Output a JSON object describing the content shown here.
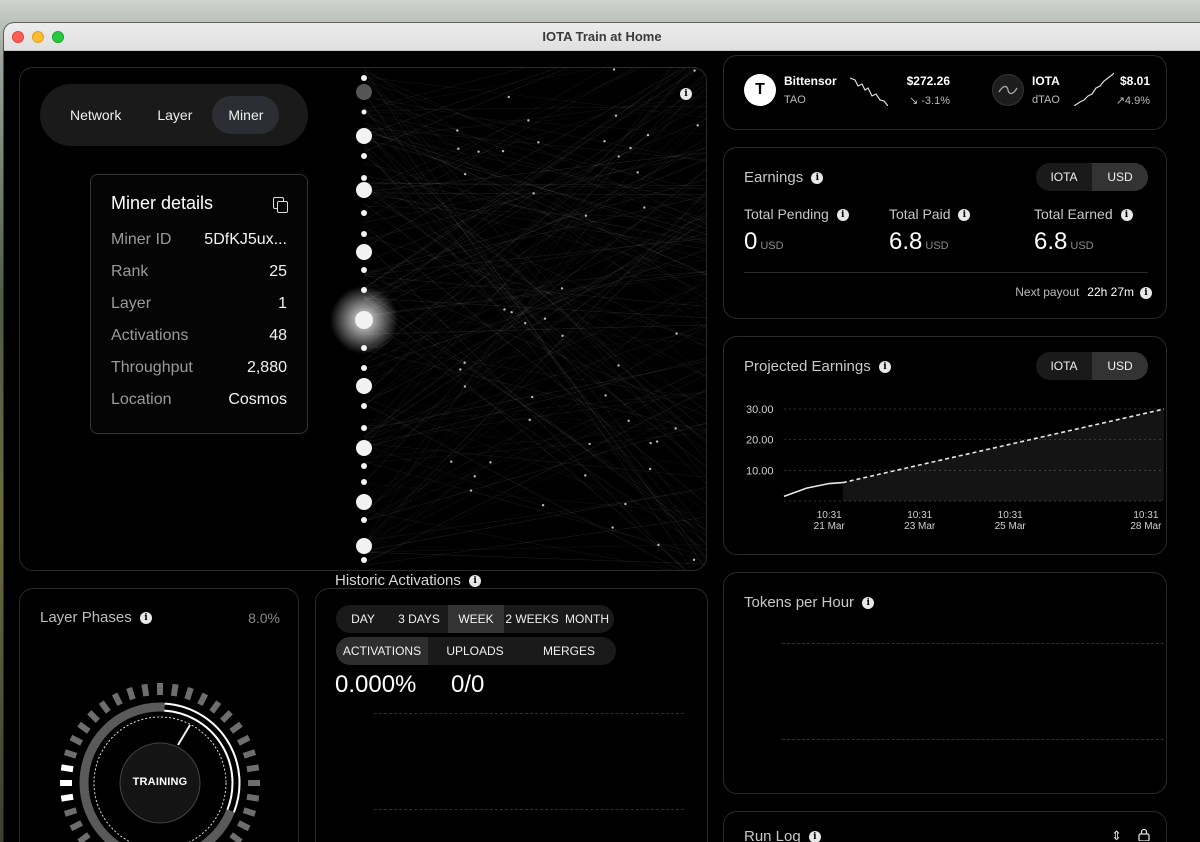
{
  "window": {
    "title": "IOTA Train at Home"
  },
  "view_tabs": [
    "Network",
    "Layer",
    "Miner"
  ],
  "active_view_tab": "Miner",
  "miner_details": {
    "title": "Miner details",
    "rows": [
      {
        "key": "Miner ID",
        "value": "5DfKJ5ux..."
      },
      {
        "key": "Rank",
        "value": "25"
      },
      {
        "key": "Layer",
        "value": "1"
      },
      {
        "key": "Activations",
        "value": "48"
      },
      {
        "key": "Throughput",
        "value": "2,880"
      },
      {
        "key": "Location",
        "value": "Cosmos"
      }
    ]
  },
  "ticker": {
    "bittensor": {
      "logo": "T",
      "name": "Bittensor",
      "symbol": "TAO",
      "price": "$272.26",
      "change": "↘ -3.1%"
    },
    "iota": {
      "name": "IOTA",
      "symbol": "dTAO",
      "price": "$8.01",
      "change": "↗4.9%"
    }
  },
  "earnings": {
    "title": "Earnings",
    "currency_options": [
      "IOTA",
      "USD"
    ],
    "active_currency": "USD",
    "items": [
      {
        "label": "Total Pending",
        "value": "0",
        "unit": "USD"
      },
      {
        "label": "Total Paid",
        "value": "6.8",
        "unit": "USD"
      },
      {
        "label": "Total Earned",
        "value": "6.8",
        "unit": "USD"
      }
    ],
    "next_payout_label": "Next payout",
    "next_payout_value": "22h 27m"
  },
  "projected": {
    "title": "Projected Earnings",
    "currency_options": [
      "IOTA",
      "USD"
    ],
    "active_currency": "USD"
  },
  "chart_data": {
    "type": "line",
    "title": "Projected Earnings",
    "ylim": [
      0,
      30
    ],
    "yticks": [
      "30.00",
      "20.00",
      "10.00"
    ],
    "xticks": [
      {
        "time": "10:31",
        "date": "21 Mar"
      },
      {
        "time": "10:31",
        "date": "23 Mar"
      },
      {
        "time": "10:31",
        "date": "25 Mar"
      },
      {
        "time": "10:31",
        "date": "28 Mar"
      }
    ],
    "series": [
      {
        "style": "solid",
        "x": [
          "20 Mar",
          "20.5 Mar",
          "21 Mar",
          "21.3 Mar"
        ],
        "values": [
          1.5,
          4.2,
          5.7,
          6.0
        ]
      },
      {
        "style": "dashed",
        "x": [
          "21.3 Mar",
          "28.4 Mar"
        ],
        "values": [
          6.0,
          30.0
        ]
      }
    ],
    "grid": true
  },
  "layer_phases": {
    "title": "Layer Phases",
    "percent": "8.0%",
    "phase": "TRAINING"
  },
  "historic": {
    "title": "Historic Activations",
    "ranges": [
      "DAY",
      "3 DAYS",
      "WEEK",
      "2 WEEKS",
      "MONTH"
    ],
    "active_range": "WEEK",
    "metrics": [
      "ACTIVATIONS",
      "UPLOADS",
      "MERGES"
    ],
    "active_metric": "ACTIVATIONS",
    "primary_value": "0.000%",
    "secondary_value": "0/0"
  },
  "tokens": {
    "title": "Tokens per Hour"
  },
  "run_log": {
    "title": "Run Log"
  },
  "icons": {
    "info": "info-icon",
    "copy": "copy-icon",
    "sort": "sort-updown-icon",
    "lock": "lock-icon"
  },
  "colors": {
    "background": "#000000",
    "panel_border": "#2a2a2a",
    "accent_toggle": "#333333",
    "text_primary": "#ffffff",
    "text_muted": "#9a9a9a"
  }
}
